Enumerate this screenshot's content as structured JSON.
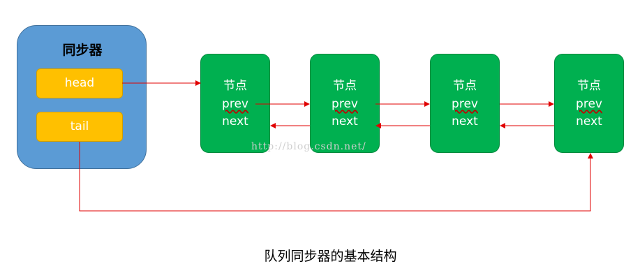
{
  "synchronizer": {
    "title": "同步器",
    "head_label": "head",
    "tail_label": "tail"
  },
  "nodes": [
    {
      "title": "节点",
      "prev": "prev",
      "next": "next"
    },
    {
      "title": "节点",
      "prev": "prev",
      "next": "next"
    },
    {
      "title": "节点",
      "prev": "prev",
      "next": "next"
    },
    {
      "title": "节点",
      "prev": "prev",
      "next": "next"
    }
  ],
  "caption": "队列同步器的基本结构",
  "watermark": "http://blog.csdn.net/",
  "colors": {
    "synchronizer_fill": "#5b9bd5",
    "field_fill": "#ffc000",
    "node_fill": "#00b050",
    "link_color": "#e00000"
  }
}
